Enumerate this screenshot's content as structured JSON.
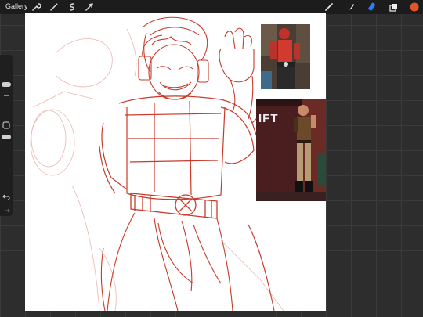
{
  "app": {
    "gallery_label": "Gallery"
  },
  "toolbar": {
    "left_tools": [
      "wrench-icon",
      "magic-wand-icon",
      "selection-icon",
      "transform-arrow-icon"
    ],
    "right_tools": [
      "brush-icon",
      "smudge-icon",
      "eraser-icon",
      "layers-icon",
      "color-swatch"
    ],
    "active_tool": "eraser-icon",
    "active_color": "#e0532b"
  },
  "reference_images": {
    "top_ref_caption": "",
    "bottom_ref_sign_text": "IFT"
  },
  "colors": {
    "sketch": "#c83a2a",
    "sketch_light": "#e9a8a0",
    "accent_blue": "#2f7bf6"
  }
}
